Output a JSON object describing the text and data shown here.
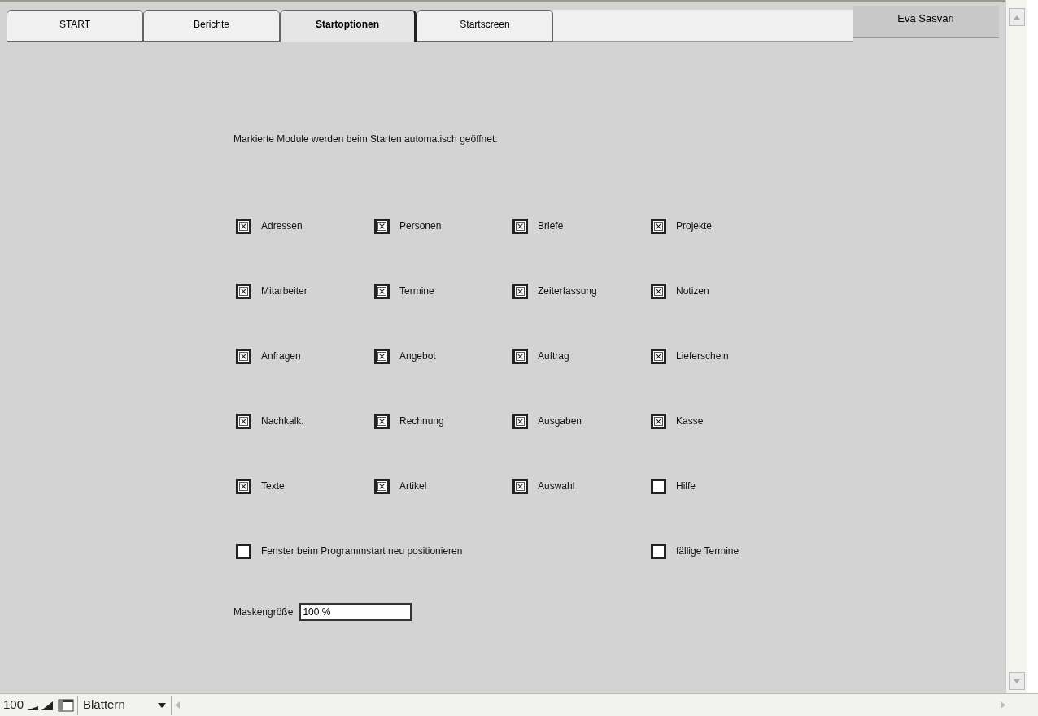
{
  "tabs": [
    {
      "label": "START",
      "selected": false
    },
    {
      "label": "Berichte",
      "selected": false
    },
    {
      "label": "Startoptionen",
      "selected": true
    },
    {
      "label": "Startscreen",
      "selected": false
    }
  ],
  "user_name": "Eva Sasvari",
  "intro": "Markierte Module werden beim Starten automatisch geöffnet:",
  "modules": [
    {
      "label": "Adressen",
      "checked": true
    },
    {
      "label": "Personen",
      "checked": true
    },
    {
      "label": "Briefe",
      "checked": true
    },
    {
      "label": "Projekte",
      "checked": true
    },
    {
      "label": "Mitarbeiter",
      "checked": true
    },
    {
      "label": "Termine",
      "checked": true
    },
    {
      "label": "Zeiterfassung",
      "checked": true
    },
    {
      "label": "Notizen",
      "checked": true
    },
    {
      "label": "Anfragen",
      "checked": true
    },
    {
      "label": "Angebot",
      "checked": true
    },
    {
      "label": "Auftrag",
      "checked": true
    },
    {
      "label": "Lieferschein",
      "checked": true
    },
    {
      "label": "Nachkalk.",
      "checked": true
    },
    {
      "label": "Rechnung",
      "checked": true
    },
    {
      "label": "Ausgaben",
      "checked": true
    },
    {
      "label": "Kasse",
      "checked": true
    },
    {
      "label": "Texte",
      "checked": true
    },
    {
      "label": "Artikel",
      "checked": true
    },
    {
      "label": "Auswahl",
      "checked": true
    },
    {
      "label": "Hilfe",
      "checked": false
    }
  ],
  "options": [
    {
      "label": "Fenster beim Programmstart neu positionieren",
      "checked": false
    },
    {
      "label": "fällige Termine",
      "checked": false
    }
  ],
  "mask_size": {
    "label": "Maskengröße",
    "value": "100 %"
  },
  "status_bar": {
    "zoom": "100",
    "mode": "Blättern"
  }
}
